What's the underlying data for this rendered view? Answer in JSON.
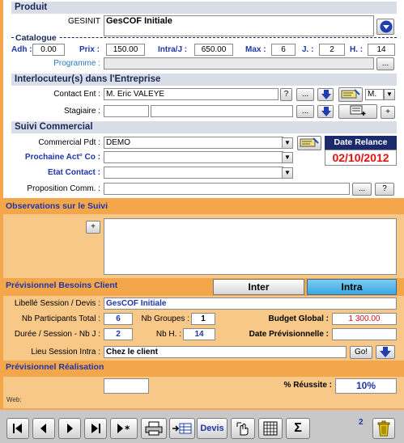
{
  "produit": {
    "section_title": "Produit",
    "gesinit_label": "GESINIT",
    "gesinit_value": "GesCOF Initiale"
  },
  "catalogue": {
    "title": "Catalogue",
    "adh_label": "Adh :",
    "adh_value": "0.00",
    "prix_label": "Prix :",
    "prix_value": "150.00",
    "intra_label": "Intra/J :",
    "intra_value": "650.00",
    "max_label": "Max :",
    "max_value": "6",
    "j_label": "J. :",
    "j_value": "2",
    "h_label": "H. :",
    "h_value": "14",
    "programme_label": "Programme :",
    "programme_value": "",
    "ellipsis": "..."
  },
  "interlocuteurs": {
    "section_title": "Interlocuteur(s) dans l'Entreprise",
    "contact_label": "Contact Ent :",
    "contact_value": "M. Eric VALEYE",
    "question": "?",
    "ellipsis": "...",
    "civilite_value": "M.",
    "stagiaire_label": "Stagiaire :",
    "plus": "+"
  },
  "suivi": {
    "section_title": "Suivi Commercial",
    "commercial_label": "Commercial Pdt :",
    "commercial_value": "DEMO",
    "prochaine_label": "Prochaine Act° Co :",
    "etat_label": "Etat Contact :",
    "proposition_label": "Proposition Comm. :",
    "date_relance_label": "Date Relance",
    "date_relance_value": "02/10/2012",
    "ellipsis": "...",
    "question": "?"
  },
  "observations": {
    "title": "Observations sur le Suivi",
    "plus": "+"
  },
  "besoins": {
    "title": "Prévisionnel Besoins Client",
    "tab_inter": "Inter",
    "tab_intra": "Intra",
    "libelle_label": "Libellé Session / Devis :",
    "libelle_value": "GesCOF Initiale",
    "participants_label": "Nb Participants Total :",
    "participants_value": "6",
    "groupes_label": "Nb Groupes :",
    "groupes_value": "1",
    "budget_label": "Budget Global :",
    "budget_value": "1 300.00",
    "duree_label": "Durée / Session - Nb J :",
    "duree_value": "2",
    "nbh_label": "Nb H. :",
    "nbh_value": "14",
    "date_prev_label": "Date Prévisionnelle :",
    "date_prev_value": "",
    "lieu_label": "Lieu Session Intra :",
    "lieu_value": "Chez le client",
    "go_label": "Go!"
  },
  "realisation": {
    "title": "Prévisionnel Réalisation",
    "reussite_label": "% Réussite :",
    "reussite_value": "10%",
    "web_label": "Web:"
  },
  "toolbar": {
    "devis_label": "Devis",
    "count": "2"
  },
  "colors": {
    "orange_dark": "#f3a64a",
    "orange_light": "#f8c888",
    "section_header": "#d8dde8",
    "label_blue": "#1f35a8",
    "date_red": "#e01010",
    "date_relance_bg": "#1a2a6c"
  }
}
